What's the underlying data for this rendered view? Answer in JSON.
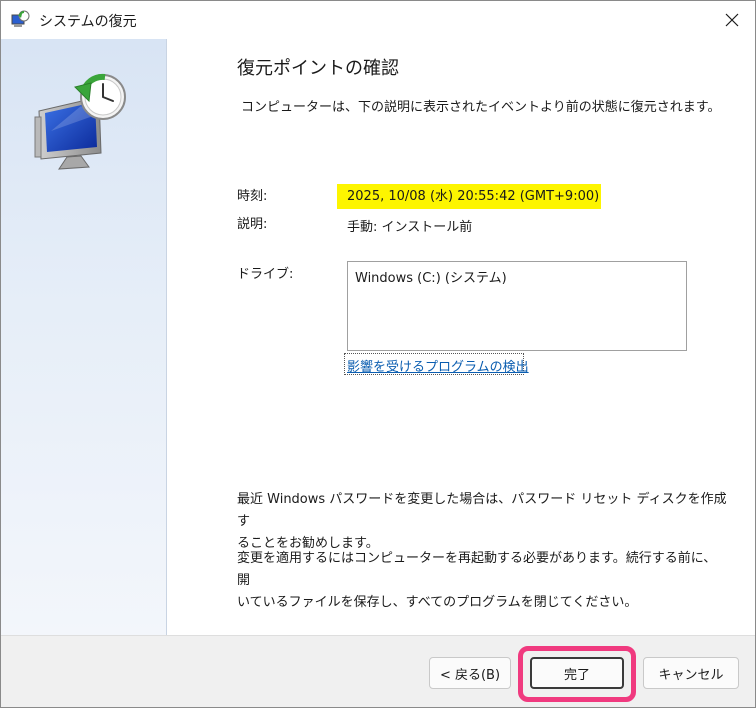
{
  "window": {
    "title": "システムの復元"
  },
  "content": {
    "heading": "復元ポイントの確認",
    "intro": "コンピューターは、下の説明に表示されたイベントより前の状態に復元されます。",
    "fields": {
      "time_label": "時刻:",
      "time_value": "2025, 10/08 (水) 20:55:42 (GMT+9:00)",
      "description_label": "説明:",
      "description_value": "手動: インストール前",
      "drive_label": "ドライブ:",
      "drives": [
        "Windows (C:) (システム)"
      ]
    },
    "scan_link": "影響を受けるプログラムの検出",
    "note_password_line1": "最近 Windows パスワードを変更した場合は、パスワード リセット ディスクを作成す",
    "note_password_line2": "ることをお勧めします。",
    "note_restart_line1": "変更を適用するにはコンピューターを再起動する必要があります。続行する前に、開",
    "note_restart_line2": "いているファイルを保存し、すべてのプログラムを閉じてください。"
  },
  "buttons": {
    "back": "< 戻る(B)",
    "finish": "完了",
    "cancel": "キャンセル"
  },
  "colors": {
    "highlight": "#fdf500",
    "callout": "#f03a7f",
    "link": "#0a5db0"
  }
}
